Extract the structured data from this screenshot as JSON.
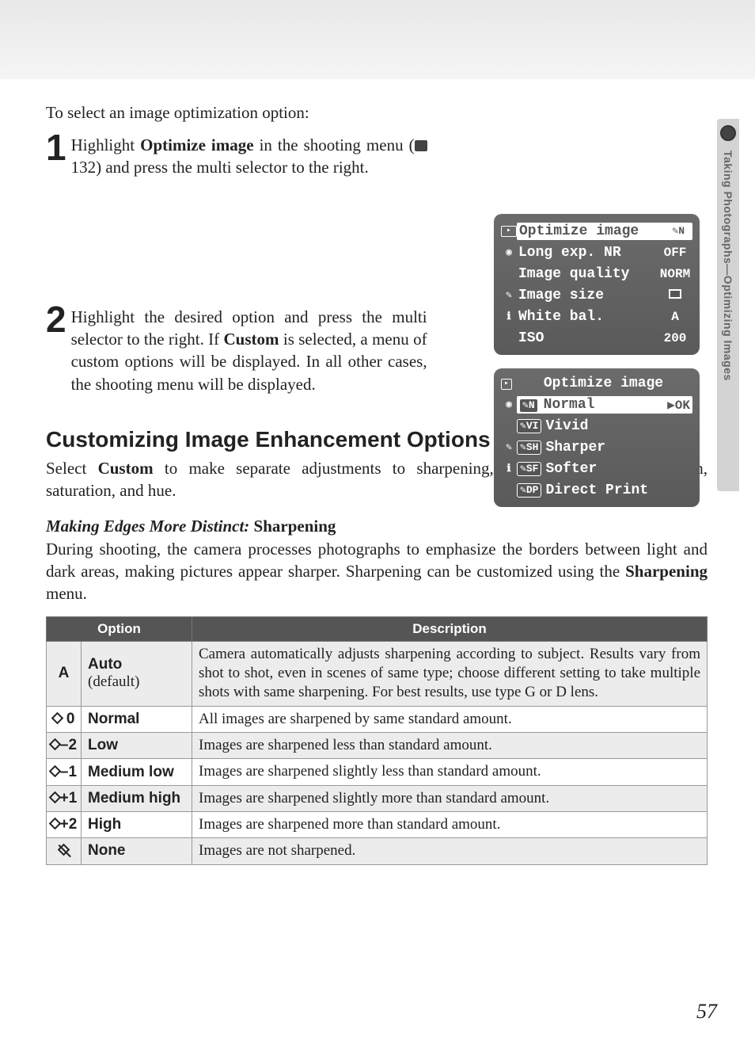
{
  "sideTab": {
    "label": "Taking Photographs—Optimizing Images"
  },
  "intro": "To select an image optimization option:",
  "steps": [
    {
      "num": "1",
      "textBefore": "Highlight ",
      "bold1": "Optimize image",
      "textMid": " in the shooting menu (",
      "ref": " 132) and press the multi selector to the right."
    },
    {
      "num": "2",
      "textBefore": "Highlight the desired option and press the multi selector to the right.  If ",
      "bold1": "Custom",
      "textAfter": " is selected, a menu of custom options will be displayed.  In all other cases, the shooting menu will be displayed."
    }
  ],
  "camScreens": {
    "s1": {
      "rows": [
        {
          "icon": "▸",
          "label": "Optimize image",
          "val": "N",
          "hl": true,
          "badge": true
        },
        {
          "icon": "",
          "label": "Long exp. NR",
          "val": "OFF"
        },
        {
          "icon": "",
          "label": "Image quality",
          "val": "NORM"
        },
        {
          "icon": "✎",
          "label": "Image size",
          "val": "▫"
        },
        {
          "icon": "ℹ",
          "label": "White bal.",
          "val": "A"
        },
        {
          "icon": "",
          "label": "ISO",
          "val": "200"
        }
      ]
    },
    "s2": {
      "title": "Optimize image",
      "rows": [
        {
          "icon": "▸",
          "badge": "N",
          "label": "Normal",
          "val": "▶OK",
          "hl": true
        },
        {
          "icon": "",
          "badge": "VI",
          "label": "Vivid"
        },
        {
          "icon": "✎",
          "badge": "SH",
          "label": "Sharper"
        },
        {
          "icon": "ℹ",
          "badge": "SF",
          "label": "Softer"
        },
        {
          "icon": "",
          "badge": "DP",
          "label": "Direct Print"
        }
      ]
    }
  },
  "sectionTitle": "Customizing Image Enhancement Options",
  "sectionPara": {
    "before": "Select ",
    "bold": "Custom",
    "after": " to make separate adjustments to sharpening, contrast, color reproduction, saturation, and hue."
  },
  "subhead": {
    "ital": "Making Edges More Distinct:",
    "bold": " Sharpening"
  },
  "subpara": {
    "before": "During shooting, the camera processes photographs to emphasize the borders between light and dark areas, making pictures appear sharper.  Sharpening can be customized using the ",
    "bold": "Sharpening",
    "after": " menu."
  },
  "table": {
    "headers": {
      "opt": "Option",
      "desc": "Description"
    },
    "rows": [
      {
        "sym": "A",
        "symClass": "",
        "name": "Auto",
        "sub": "(default)",
        "desc": "Camera automatically adjusts sharpening according to subject.  Results vary from shot to shot, even in scenes of same type; choose different setting to take multiple shots with same sharpening.  For best results, use type G or D lens."
      },
      {
        "sym": " 0",
        "symClass": "d",
        "name": "Normal",
        "desc": "All images are sharpened by same standard amount."
      },
      {
        "sym": "–2",
        "symClass": "d",
        "name": "Low",
        "desc": "Images are sharpened less than standard amount."
      },
      {
        "sym": "–1",
        "symClass": "d",
        "name": "Medium low",
        "desc": "Images are sharpened slightly less than standard amount."
      },
      {
        "sym": "+1",
        "symClass": "d",
        "name": "Medium high",
        "desc": "Images are sharpened slightly more than standard amount."
      },
      {
        "sym": "+2",
        "symClass": "d",
        "name": "High",
        "desc": "Images are sharpened more than standard amount."
      },
      {
        "sym": "",
        "symClass": "ds",
        "name": "None",
        "desc": "Images are not sharpened."
      }
    ]
  },
  "pageNum": "57"
}
